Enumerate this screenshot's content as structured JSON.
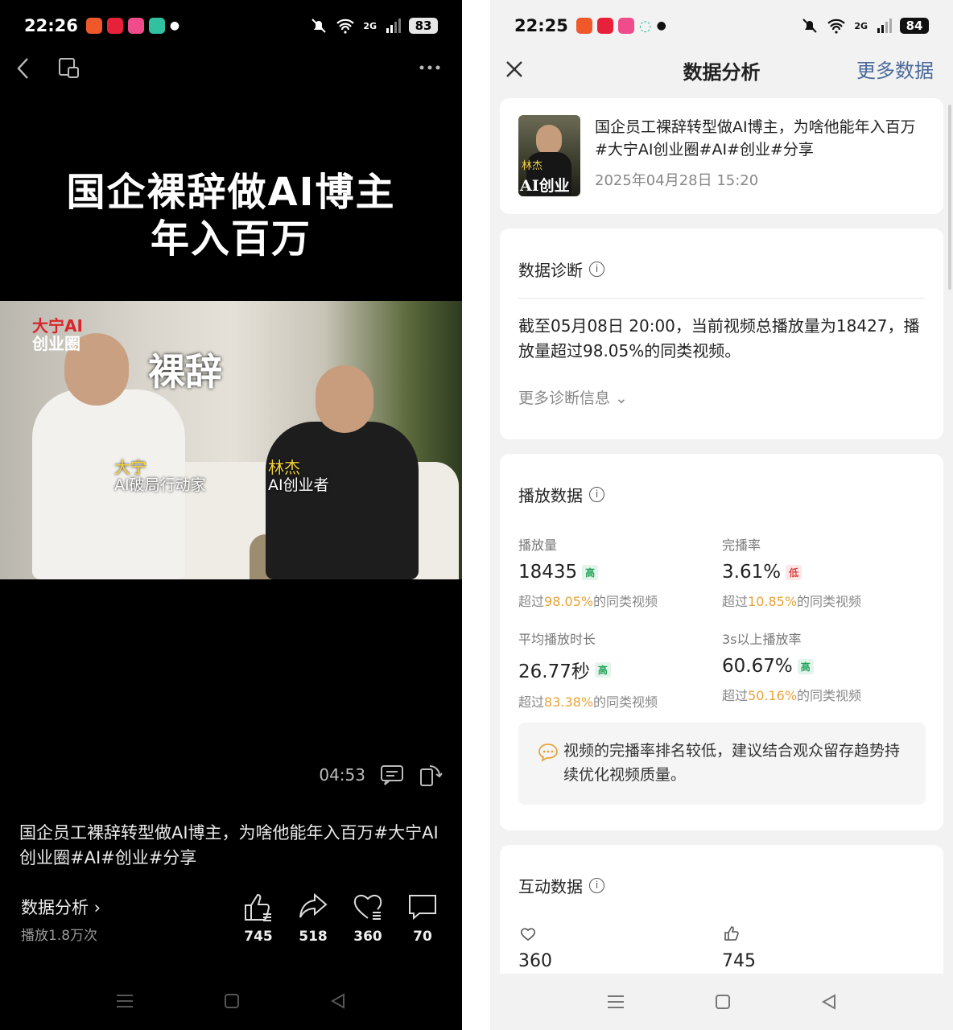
{
  "left": {
    "status": {
      "time": "22:26",
      "battery": "83",
      "net": "2G"
    },
    "title_lines": [
      "国企裸辞做AI博主",
      "年入百万"
    ],
    "video": {
      "logo_top": "大宁AI",
      "logo_bottom": "创业圈",
      "overlay": "裸辞",
      "person1_name": "大宁",
      "person1_role": "AI破局行动家",
      "person2_name": "林杰",
      "person2_role": "AI创业者"
    },
    "duration": "04:53",
    "description": "国企员工裸辞转型做AI博主，为啥他能年入百万#大宁AI创业圈#AI#创业#分享",
    "analysis_label": "数据分析 ›",
    "plays_label": "播放1.8万次",
    "actions": {
      "like": "745",
      "share": "518",
      "fav": "360",
      "comment": "70"
    }
  },
  "right": {
    "status": {
      "time": "22:25",
      "battery": "84",
      "net": "2G"
    },
    "header": {
      "title": "数据分析",
      "more": "更多数据"
    },
    "video_card": {
      "thumb_name": "林杰",
      "thumb_text": "AI创业",
      "title": "国企员工裸辞转型做AI博主，为啥他能年入百万#大宁AI创业圈#AI#创业#分享",
      "date": "2025年04月28日 15:20"
    },
    "diagnosis": {
      "title": "数据诊断",
      "text": "截至05月08日 20:00，当前视频总播放量为18427，播放量超过98.05%的同类视频。",
      "more": "更多诊断信息 ⌄"
    },
    "play": {
      "title": "播放数据",
      "m1": {
        "label": "播放量",
        "value": "18435",
        "tag": "高",
        "pre": "超过",
        "pct": "98.05%",
        "post": "的同类视频"
      },
      "m2": {
        "label": "完播率",
        "value": "3.61%",
        "tag": "低",
        "pre": "超过",
        "pct": "10.85%",
        "post": "的同类视频"
      },
      "m3": {
        "label": "平均播放时长",
        "value": "26.77秒",
        "tag": "高",
        "pre": "超过",
        "pct": "83.38%",
        "post": "的同类视频"
      },
      "m4": {
        "label": "3s以上播放率",
        "value": "60.67%",
        "tag": "高",
        "pre": "超过",
        "pct": "50.16%",
        "post": "的同类视频"
      },
      "tip": "视频的完播率排名较低，建议结合观众留存趋势持续优化视频质量。"
    },
    "interaction": {
      "title": "互动数据",
      "fav": "360",
      "like": "745"
    }
  },
  "colors": {
    "accent_orange": "#e8a33a",
    "high_green": "#22a35a",
    "low_red": "#e04444",
    "link_blue": "#4a6a9a"
  }
}
